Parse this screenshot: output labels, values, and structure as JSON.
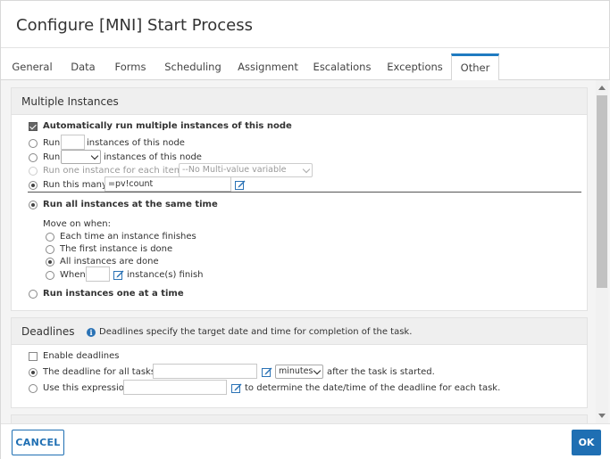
{
  "dialog": {
    "title": "Configure [MNI] Start Process"
  },
  "tabs": [
    {
      "label": "General"
    },
    {
      "label": "Data"
    },
    {
      "label": "Forms"
    },
    {
      "label": "Scheduling"
    },
    {
      "label": "Assignment"
    },
    {
      "label": "Escalations"
    },
    {
      "label": "Exceptions"
    },
    {
      "label": "Other",
      "active": true
    }
  ],
  "multiple_instances": {
    "title": "Multiple Instances",
    "auto_run_label": "Automatically run multiple instances of this node",
    "auto_run_checked": true,
    "run_label": "Run",
    "run_count_value": "",
    "instances_of_node": "instances of this node",
    "run_select_value": "",
    "run_one_each_label": "Run one instance for each item in",
    "run_one_each_select": "--No Multi-value variable found",
    "run_this_many_label": "Run this many:",
    "run_this_many_value": "=pv!count",
    "run_all_label": "Run all instances at the same time",
    "move_on_label": "Move on when:",
    "move_on_options": [
      {
        "label": "Each time an instance finishes",
        "selected": false
      },
      {
        "label": "The first instance is done",
        "selected": false
      },
      {
        "label": "All instances are done",
        "selected": true
      }
    ],
    "when_label": "When",
    "when_value": "",
    "when_suffix": "instance(s) finish",
    "one_at_a_time_label": "Run instances one at a time"
  },
  "deadlines": {
    "title": "Deadlines",
    "info_text": "Deadlines specify the target date and time for completion of the task.",
    "enable_label": "Enable deadlines",
    "enable_checked": false,
    "all_tasks_label": "The deadline for all tasks is",
    "all_tasks_value": "",
    "unit_select": "minutes",
    "after_started": "after the task is started.",
    "expression_label": "Use this expression",
    "expression_value": "",
    "expression_suffix": "to determine the date/time of the deadline for each task."
  },
  "footer": {
    "cancel_label": "CANCEL",
    "ok_label": "OK"
  },
  "colors": {
    "accent": "#1f6fb3",
    "tab_active_border": "#1f7bc1",
    "panel_header": "#efefef"
  },
  "icons": {
    "edit": "edit-icon",
    "info": "info-icon"
  }
}
